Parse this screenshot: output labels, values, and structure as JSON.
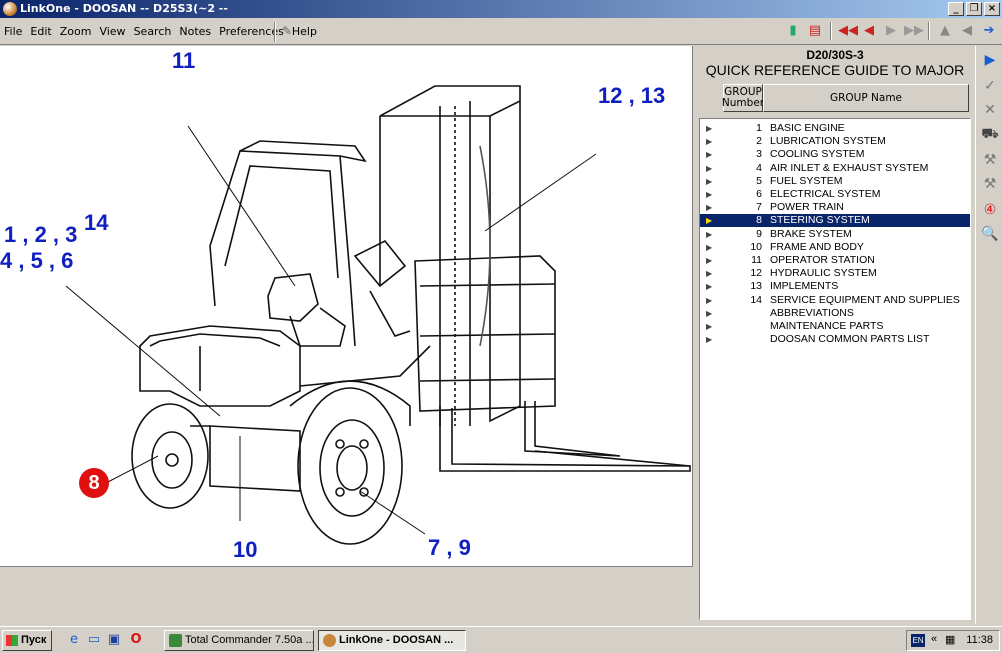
{
  "window": {
    "title": "LinkOne - DOOSAN -- D25S3(~2 --",
    "controls": [
      "_",
      "❐",
      "×"
    ]
  },
  "menu": [
    "File",
    "Edit",
    "Zoom",
    "View",
    "Search",
    "Notes",
    "Preferences",
    "Help"
  ],
  "diagram": {
    "callouts": {
      "c11": "11",
      "c1213": "12 , 13",
      "c123": "1 , 2 , 3",
      "c14": "14",
      "c456": "4 , 5 , 6",
      "c8": "8",
      "c10": "10",
      "c79": "7 , 9"
    }
  },
  "guide": {
    "model": "D20/30S-3",
    "title": "QUICK REFERENCE GUIDE TO MAJOR",
    "col_number": "GROUP Number",
    "col_name": "GROUP Name",
    "groups": [
      {
        "num": "1",
        "name": "BASIC ENGINE"
      },
      {
        "num": "2",
        "name": "LUBRICATION SYSTEM"
      },
      {
        "num": "3",
        "name": "COOLING SYSTEM"
      },
      {
        "num": "4",
        "name": "AIR INLET & EXHAUST SYSTEM"
      },
      {
        "num": "5",
        "name": "FUEL SYSTEM"
      },
      {
        "num": "6",
        "name": "ELECTRICAL SYSTEM"
      },
      {
        "num": "7",
        "name": "POWER TRAIN"
      },
      {
        "num": "8",
        "name": "STEERING SYSTEM"
      },
      {
        "num": "9",
        "name": "BRAKE SYSTEM"
      },
      {
        "num": "10",
        "name": "FRAME AND BODY"
      },
      {
        "num": "11",
        "name": "OPERATOR STATION"
      },
      {
        "num": "12",
        "name": "HYDRAULIC SYSTEM"
      },
      {
        "num": "13",
        "name": "IMPLEMENTS"
      },
      {
        "num": "14",
        "name": "SERVICE EQUIPMENT AND SUPPLIES"
      },
      {
        "num": "",
        "name": "ABBREVIATIONS"
      },
      {
        "num": "",
        "name": "MAINTENANCE PARTS"
      },
      {
        "num": "",
        "name": "DOOSAN COMMON PARTS LIST"
      }
    ],
    "selected_index": 7
  },
  "taskbar": {
    "start": "Пуск",
    "tasks": [
      "Total Commander 7.50a ...",
      "LinkOne - DOOSAN ..."
    ],
    "lang": "EN",
    "clock": "11:38"
  },
  "colors": {
    "callout_blue": "#1020c0",
    "callout_red": "#e01010",
    "selection": "#0a246a"
  }
}
